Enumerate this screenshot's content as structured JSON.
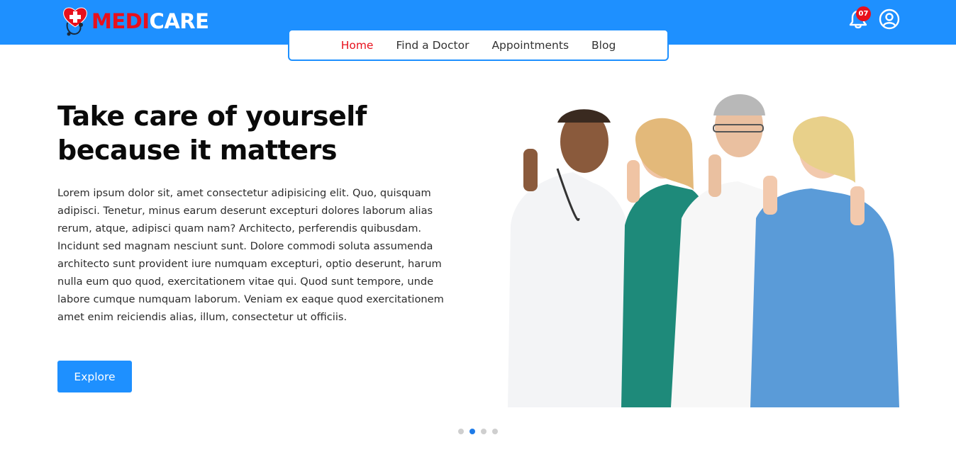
{
  "brand": {
    "part1": "MEDI",
    "part2": "CARE"
  },
  "nav": {
    "items": [
      {
        "label": "Home",
        "active": true
      },
      {
        "label": "Find a Doctor",
        "active": false
      },
      {
        "label": "Appointments",
        "active": false
      },
      {
        "label": "Blog",
        "active": false
      }
    ]
  },
  "header": {
    "notification_count": "07",
    "bell_icon": "bell-icon",
    "user_icon": "user-circle-icon"
  },
  "hero": {
    "title": "Take care of yourself because it matters",
    "body": "Lorem ipsum dolor sit, amet consectetur adipisicing elit. Quo, quisquam adipisci. Tenetur, minus earum deserunt excepturi dolores laborum alias rerum, atque, adipisci quam nam? Architecto, perferendis quibusdam. Incidunt sed magnam nesciunt sunt. Dolore commodi soluta assumenda architecto sunt provident iure numquam excepturi, optio deserunt, harum nulla eum quo quod, exercitationem vitae qui. Quod sunt tempore, unde labore cumque numquam laborum. Veniam ex eaque quod exercitationem amet enim reiciendis alias, illum, consectetur ut officiis.",
    "button_label": "Explore"
  },
  "carousel": {
    "count": 4,
    "active_index": 1
  },
  "colors": {
    "primary": "#1e90ff",
    "accent": "#e8101c",
    "white": "#ffffff"
  }
}
